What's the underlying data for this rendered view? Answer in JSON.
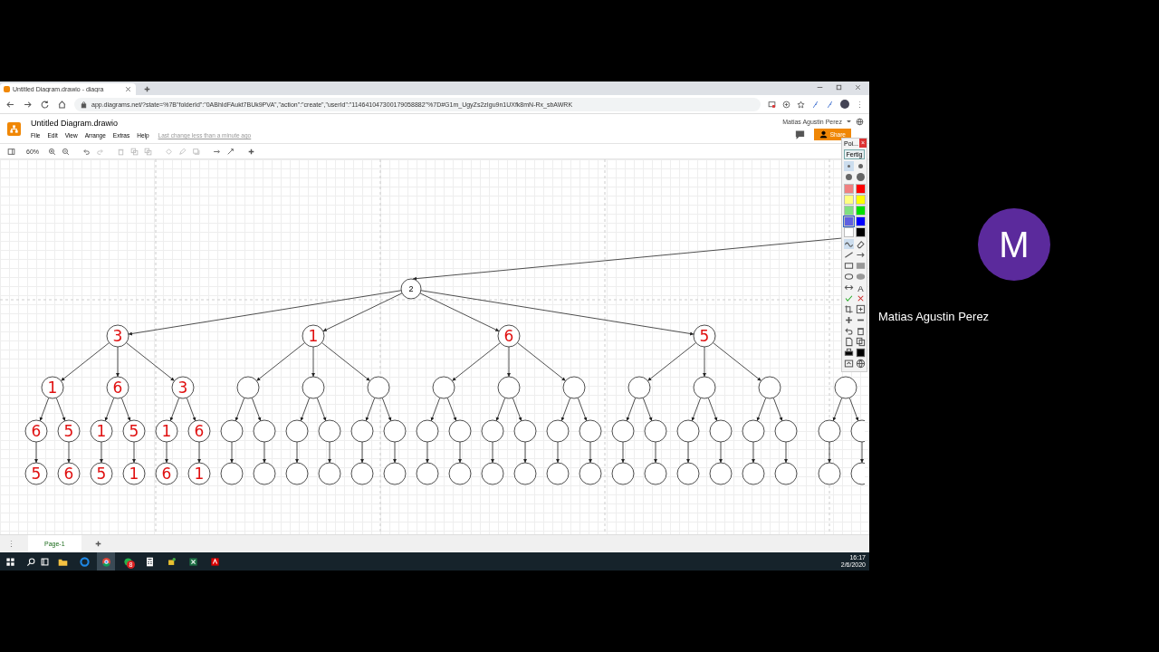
{
  "browser": {
    "tab": {
      "title": "Untitled Diagram.drawio - diagra",
      "selected": true
    },
    "url": "app.diagrams.net/?state=%7B\"folderId\":\"0ABhIdFAukt7BUk9PVA\",\"action\":\"create\",\"userId\":\"114641047300179058882\"%7D#G1m_UgyZs2zIgu9n1UXfk8mN-Rx_sbAWRK"
  },
  "app": {
    "title": "Untitled Diagram.drawio",
    "menu": [
      "File",
      "Edit",
      "View",
      "Arrange",
      "Extras",
      "Help"
    ],
    "last_change": "Last change less than a minute ago",
    "user": "Matias Agustin Perez",
    "share": "Share"
  },
  "toolbar": {
    "zoom": "60%",
    "tools": [
      {
        "kind": "zoom-in",
        "disabled": false
      },
      {
        "kind": "zoom-out",
        "disabled": false
      },
      {
        "kind": "undo",
        "disabled": false
      },
      {
        "kind": "redo",
        "disabled": true
      },
      {
        "kind": "trash",
        "disabled": true
      },
      {
        "kind": "front",
        "disabled": true
      },
      {
        "kind": "back",
        "disabled": true
      },
      {
        "kind": "fill",
        "disabled": true
      },
      {
        "kind": "pencil",
        "disabled": true
      },
      {
        "kind": "shadow",
        "disabled": true
      },
      {
        "kind": "arrow",
        "disabled": false
      },
      {
        "kind": "waypoint",
        "disabled": false
      },
      {
        "kind": "plus",
        "disabled": false
      }
    ]
  },
  "diagram": {
    "trees": [
      {
        "kind": "root",
        "node": {
          "label": "2",
          "handwritten": false,
          "children": [
            {
              "label": "3",
              "handwritten": true,
              "children": [
                {
                  "label": "1",
                  "handwritten": true,
                  "children": [
                    {
                      "label": "6",
                      "handwritten": true,
                      "children": [
                        {
                          "label": "5",
                          "handwritten": true
                        }
                      ]
                    },
                    {
                      "label": "5",
                      "handwritten": true,
                      "children": [
                        {
                          "label": "6",
                          "handwritten": true
                        }
                      ]
                    }
                  ]
                },
                {
                  "label": "6",
                  "handwritten": true,
                  "children": [
                    {
                      "label": "1",
                      "handwritten": true,
                      "children": [
                        {
                          "label": "5",
                          "handwritten": true
                        }
                      ]
                    },
                    {
                      "label": "5",
                      "handwritten": true,
                      "children": [
                        {
                          "label": "1",
                          "handwritten": true
                        }
                      ]
                    }
                  ]
                },
                {
                  "label": "3",
                  "handwritten": true,
                  "children": [
                    {
                      "label": "1",
                      "handwritten": true,
                      "children": [
                        {
                          "label": "6",
                          "handwritten": true
                        }
                      ]
                    },
                    {
                      "label": "6",
                      "handwritten": true,
                      "children": [
                        {
                          "label": "1",
                          "handwritten": true
                        }
                      ]
                    }
                  ]
                }
              ]
            },
            {
              "label": "1",
              "handwritten": true,
              "children": [
                {
                  "children": [
                    {
                      "children": [
                        {
                          "kind": "circle"
                        }
                      ]
                    },
                    {
                      "children": [
                        {
                          "kind": "circle"
                        }
                      ]
                    }
                  ]
                },
                {
                  "children": [
                    {
                      "children": [
                        {
                          "kind": "circle"
                        }
                      ]
                    },
                    {
                      "children": [
                        {
                          "kind": "circle"
                        }
                      ]
                    }
                  ]
                },
                {
                  "children": [
                    {
                      "children": [
                        {
                          "kind": "circle"
                        }
                      ]
                    },
                    {
                      "children": [
                        {
                          "kind": "circle"
                        }
                      ]
                    }
                  ]
                }
              ]
            },
            {
              "label": "6",
              "handwritten": true,
              "children": [
                {
                  "children": [
                    {
                      "children": [
                        {
                          "kind": "circle"
                        }
                      ]
                    },
                    {
                      "children": [
                        {
                          "kind": "circle"
                        }
                      ]
                    }
                  ]
                },
                {
                  "children": [
                    {
                      "children": [
                        {
                          "kind": "circle"
                        }
                      ]
                    },
                    {
                      "children": [
                        {
                          "kind": "circle"
                        }
                      ]
                    }
                  ]
                },
                {
                  "children": [
                    {
                      "children": [
                        {
                          "kind": "circle"
                        }
                      ]
                    },
                    {
                      "children": [
                        {
                          "kind": "circle"
                        }
                      ]
                    }
                  ]
                }
              ]
            },
            {
              "label": "5",
              "handwritten": true,
              "children": [
                {
                  "children": [
                    {
                      "children": [
                        {
                          "kind": "circle"
                        }
                      ]
                    },
                    {
                      "children": [
                        {
                          "kind": "circle"
                        }
                      ]
                    }
                  ]
                },
                {
                  "children": [
                    {
                      "children": [
                        {
                          "kind": "circle"
                        }
                      ]
                    },
                    {
                      "children": [
                        {
                          "kind": "circle"
                        }
                      ]
                    }
                  ]
                },
                {
                  "children": [
                    {
                      "children": [
                        {
                          "kind": "circle"
                        }
                      ]
                    },
                    {
                      "children": [
                        {
                          "kind": "circle"
                        }
                      ]
                    }
                  ]
                }
              ]
            }
          ]
        }
      },
      {
        "kind": "branch",
        "node": {
          "children": [
            {
              "children": [
                {
                  "kind": "circle"
                }
              ]
            },
            {
              "children": [
                {
                  "kind": "circle"
                }
              ]
            }
          ]
        }
      }
    ]
  },
  "pen_palette": {
    "title": "Poi...",
    "close": "×",
    "done": "Fertig",
    "sizes": [
      {
        "selected": true
      },
      {
        "selected": false
      },
      {
        "selected": false
      },
      {
        "selected": false
      }
    ],
    "colors": [
      {
        "color": "#f08080",
        "selected": false
      },
      {
        "color": "#ff0000",
        "selected": false
      },
      {
        "color": "#ffff80",
        "selected": false
      },
      {
        "color": "#ffff00",
        "selected": false
      },
      {
        "color": "#80e080",
        "selected": false
      },
      {
        "color": "#00e000",
        "selected": false
      },
      {
        "color": "#6060e0",
        "selected": true
      },
      {
        "color": "#0000ff",
        "selected": false
      },
      {
        "color": "#ffffff",
        "selected": false
      },
      {
        "color": "#000000",
        "selected": false
      }
    ],
    "tools": [
      {
        "kind": "wave",
        "selected": true
      },
      {
        "kind": "eraser",
        "selected": false
      },
      {
        "kind": "line",
        "selected": false
      },
      {
        "kind": "arrow",
        "selected": false
      },
      {
        "kind": "rect",
        "selected": false
      },
      {
        "kind": "rect-filled",
        "selected": false
      },
      {
        "kind": "ellipse",
        "selected": false
      },
      {
        "kind": "ellipse-filled",
        "selected": false
      },
      {
        "kind": "double-arrow",
        "selected": false
      },
      {
        "kind": "text",
        "glyph": "A",
        "selected": false
      },
      {
        "kind": "check",
        "selected": false
      },
      {
        "kind": "cross",
        "selected": false
      },
      {
        "kind": "crop",
        "selected": false
      },
      {
        "kind": "zoom-box",
        "selected": false
      },
      {
        "kind": "plus",
        "selected": false
      },
      {
        "kind": "minus",
        "selected": false
      },
      {
        "kind": "undo",
        "selected": false
      },
      {
        "kind": "trash",
        "selected": false
      },
      {
        "kind": "page",
        "selected": false
      },
      {
        "kind": "copy",
        "selected": false
      },
      {
        "kind": "print",
        "selected": false
      },
      {
        "kind": "save",
        "selected": false
      },
      {
        "kind": "screen",
        "selected": false
      },
      {
        "kind": "globe",
        "selected": false
      }
    ]
  },
  "pages": [
    {
      "label": "Page-1",
      "selected": true
    }
  ],
  "taskbar": {
    "apps": [
      {
        "kind": "folder",
        "selected": false
      },
      {
        "kind": "edge",
        "selected": false
      },
      {
        "kind": "chrome",
        "selected": true
      },
      {
        "kind": "chat",
        "badge": "8",
        "selected": false
      },
      {
        "kind": "calculator",
        "selected": false
      },
      {
        "kind": "paint",
        "selected": false
      },
      {
        "kind": "excel",
        "selected": false
      },
      {
        "kind": "acrobat",
        "selected": false
      }
    ],
    "time": "16:17",
    "date": "2/6/2020"
  },
  "participant": {
    "initial": "M",
    "name": "Matias Agustin Perez"
  }
}
